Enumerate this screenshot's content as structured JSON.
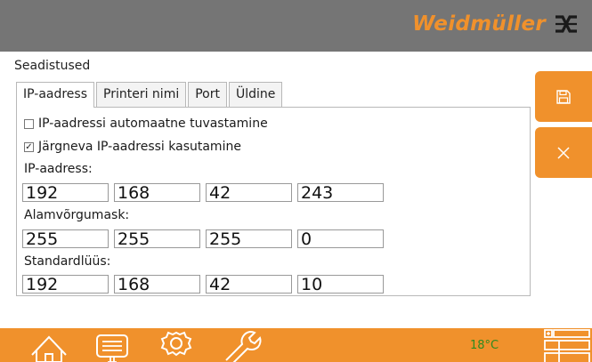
{
  "header": {
    "brand_name": "Weidmüller",
    "logo_icon": "weidmuller-logo-icon",
    "brand_color": "#f0912c",
    "background_color": "#757575"
  },
  "page": {
    "title": "Seadistused"
  },
  "tabs": [
    {
      "label": "IP-aadress",
      "active": true
    },
    {
      "label": "Printeri nimi",
      "active": false
    },
    {
      "label": "Port",
      "active": false
    },
    {
      "label": "Üldine",
      "active": false
    }
  ],
  "options": {
    "auto_detect": {
      "label": "IP-aadressi automaatne tuvastamine",
      "checked": false
    },
    "manual": {
      "label": "Järgneva IP-aadressi kasutamine",
      "checked": true
    }
  },
  "fields": {
    "ip_address": {
      "label": "IP-aadress:",
      "octets": [
        "192",
        "168",
        "42",
        "243"
      ]
    },
    "subnet_mask": {
      "label": "Alamvõrgumask:",
      "octets": [
        "255",
        "255",
        "255",
        "0"
      ]
    },
    "gateway": {
      "label": "Standardlüüs:",
      "octets": [
        "192",
        "168",
        "42",
        "10"
      ]
    }
  },
  "side_actions": {
    "save_icon": "save-icon",
    "cancel_icon": "close-icon"
  },
  "footer": {
    "icons": [
      "home-icon",
      "printer-icon",
      "gear-icon",
      "wrench-icon",
      "grid-menu-icon"
    ],
    "temperature": "18°C",
    "temperature_color": "#2e8b20"
  }
}
